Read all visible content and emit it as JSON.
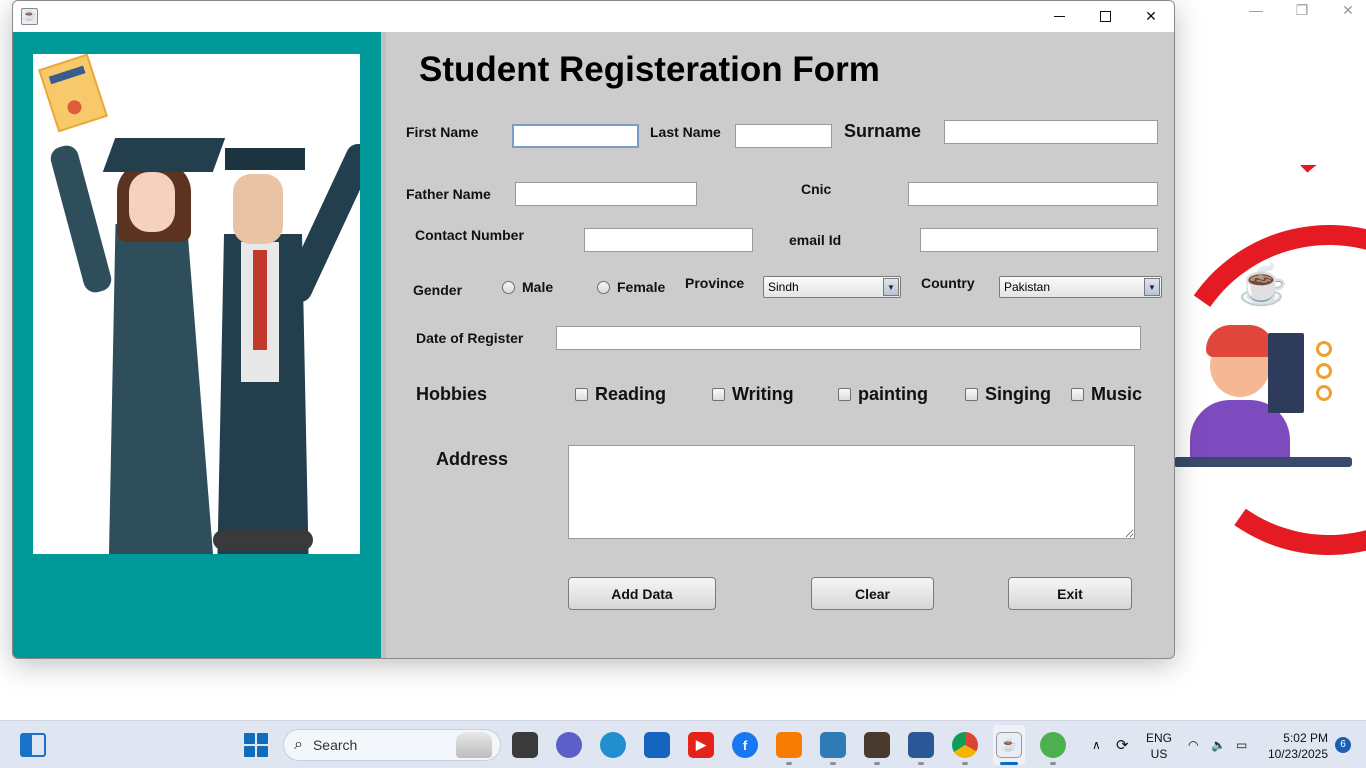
{
  "background": {
    "controls": {
      "min": "—",
      "max": "❐",
      "close": "✕"
    }
  },
  "window": {
    "title": "",
    "buttons": {
      "minimize": "—",
      "maximize": "☐",
      "close": "✕"
    }
  },
  "form": {
    "title": "Student Registeration Form",
    "labels": {
      "first_name": "First Name",
      "last_name": "Last Name",
      "surname": "Surname",
      "father_name": "Father Name",
      "cnic": "Cnic",
      "contact_number": "Contact Number",
      "email_id": "email Id",
      "gender": "Gender",
      "province": "Province",
      "country": "Country",
      "date_of_register": "Date of Register",
      "hobbies": "Hobbies",
      "address": "Address"
    },
    "values": {
      "first_name": "",
      "last_name": "",
      "surname": "",
      "father_name": "",
      "cnic": "",
      "contact_number": "",
      "email_id": "",
      "date_of_register": "",
      "address": ""
    },
    "gender_options": {
      "male": "Male",
      "female": "Female"
    },
    "province_selected": "Sindh",
    "country_selected": "Pakistan",
    "hobbies": {
      "reading": "Reading",
      "writing": "Writing",
      "painting": "painting",
      "singing": "Singing",
      "music": "Music"
    },
    "buttons": {
      "add": "Add Data",
      "clear": "Clear",
      "exit": "Exit"
    }
  },
  "taskbar": {
    "search_placeholder": "Search",
    "language": {
      "line1": "ENG",
      "line2": "US"
    },
    "time": "5:02 PM",
    "date": "10/23/2025",
    "notification_count": "6"
  }
}
